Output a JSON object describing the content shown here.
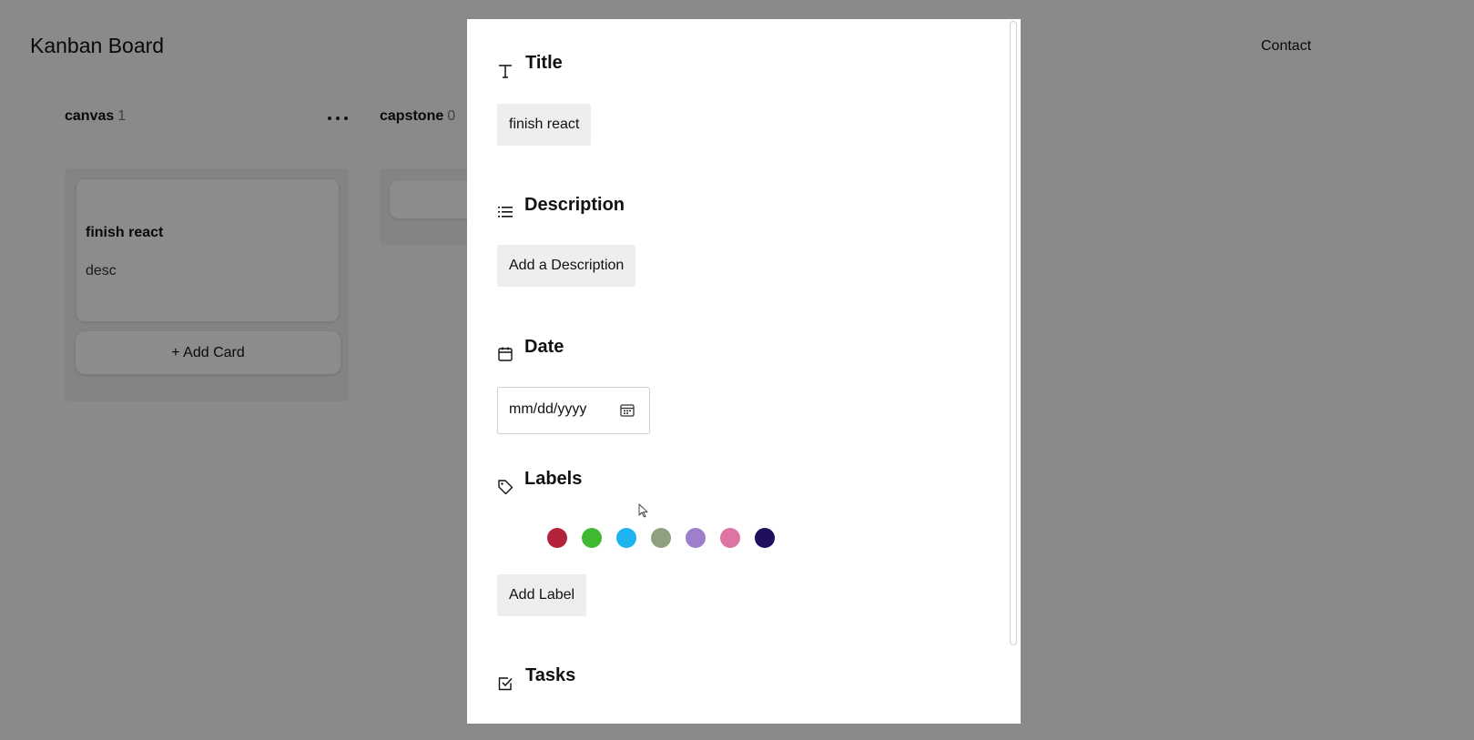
{
  "header": {
    "app_title": "Kanban Board",
    "contact_label": "Contact"
  },
  "columns": [
    {
      "name": "canvas",
      "count": "1",
      "cards": [
        {
          "title": "finish react",
          "description": "desc"
        }
      ],
      "add_card_label": "+ Add Card"
    },
    {
      "name": "capstone",
      "count": "0"
    }
  ],
  "modal": {
    "title_section": {
      "heading": "Title",
      "value": "finish react",
      "icon": "text-icon"
    },
    "description_section": {
      "heading": "Description",
      "button_label": "Add a Description",
      "icon": "list-icon"
    },
    "date_section": {
      "heading": "Date",
      "placeholder": "mm/dd/yyyy",
      "icon": "calendar-icon"
    },
    "labels_section": {
      "heading": "Labels",
      "icon": "tag-icon",
      "colors": [
        "#b3243b",
        "#3fb932",
        "#1fb4f0",
        "#8fa07f",
        "#9d7fcb",
        "#dd74a4",
        "#1f0f5c"
      ],
      "add_label": "Add Label"
    },
    "tasks_section": {
      "heading": "Tasks",
      "icon": "checkbox-icon"
    }
  }
}
